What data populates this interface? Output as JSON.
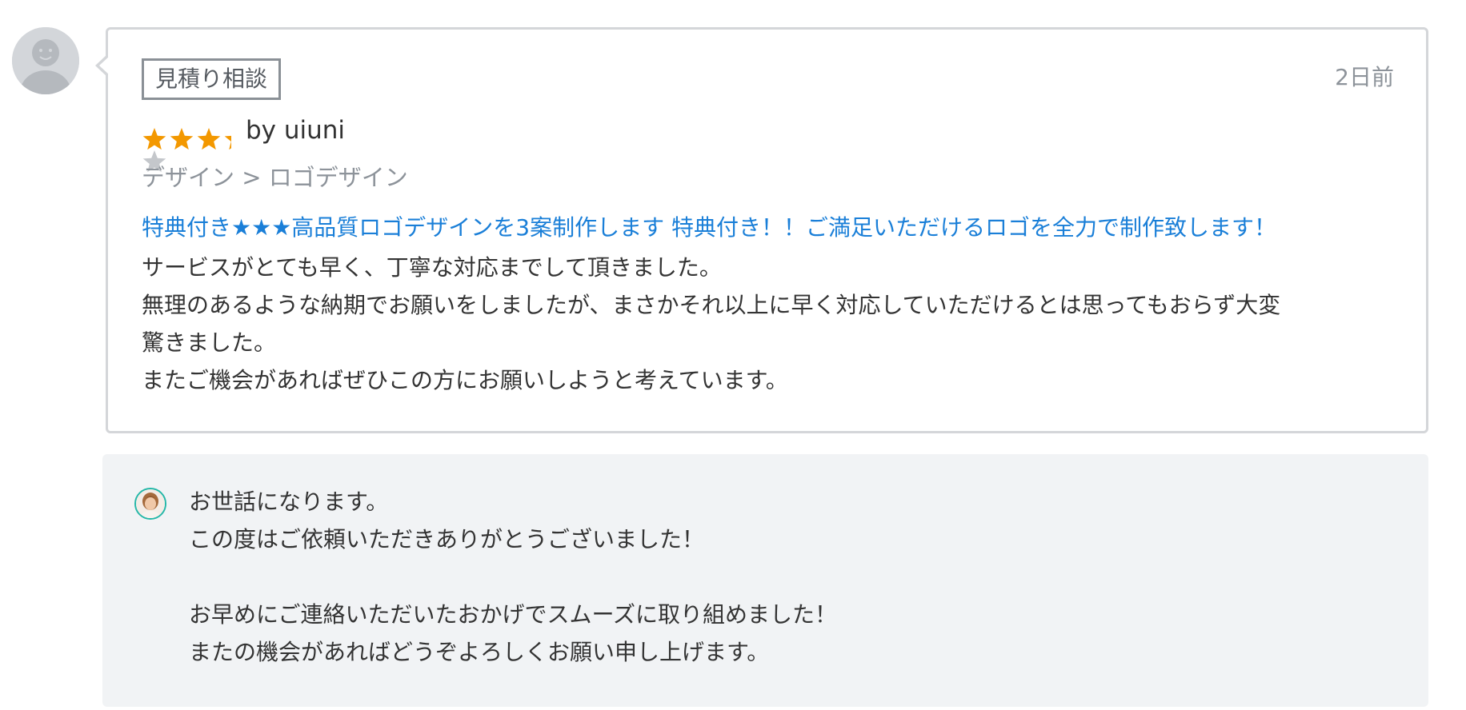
{
  "reviewer": {
    "avatar_icon": "default-user-icon"
  },
  "review": {
    "tag": "見積り相談",
    "date": "2日前",
    "rating": 3.5,
    "rating_max": 5,
    "author": "by uiuni",
    "category": "デザイン > ロゴデザイン",
    "service_link": "特典付き★★★高品質ロゴデザインを3案制作します 特典付き！！ご満足いただけるロゴを全力で制作致します！",
    "body_lines": [
      "サービスがとても早く、丁寧な対応までして頂きました。",
      "無理のあるような納期でお願いをしましたが、まさかそれ以上に早く対応していただけるとは思ってもおらず大変",
      "驚きました。",
      "またご機会があればぜひこの方にお願いしようと考えています。"
    ]
  },
  "reply": {
    "avatar_icon": "seller-avatar-icon",
    "body_lines": [
      "お世話になります。",
      "この度はご依頼いただきありがとうございました！",
      "",
      "お早めにご連絡いただいたおかげでスムーズに取り組めました！",
      "またの機会があればどうぞよろしくお願い申し上げます。"
    ]
  },
  "colors": {
    "star_filled": "#f39800",
    "star_empty": "#c4c7cb",
    "link": "#1a7fd8",
    "card_border": "#d4d6d9",
    "reply_bg": "#f1f3f5"
  }
}
